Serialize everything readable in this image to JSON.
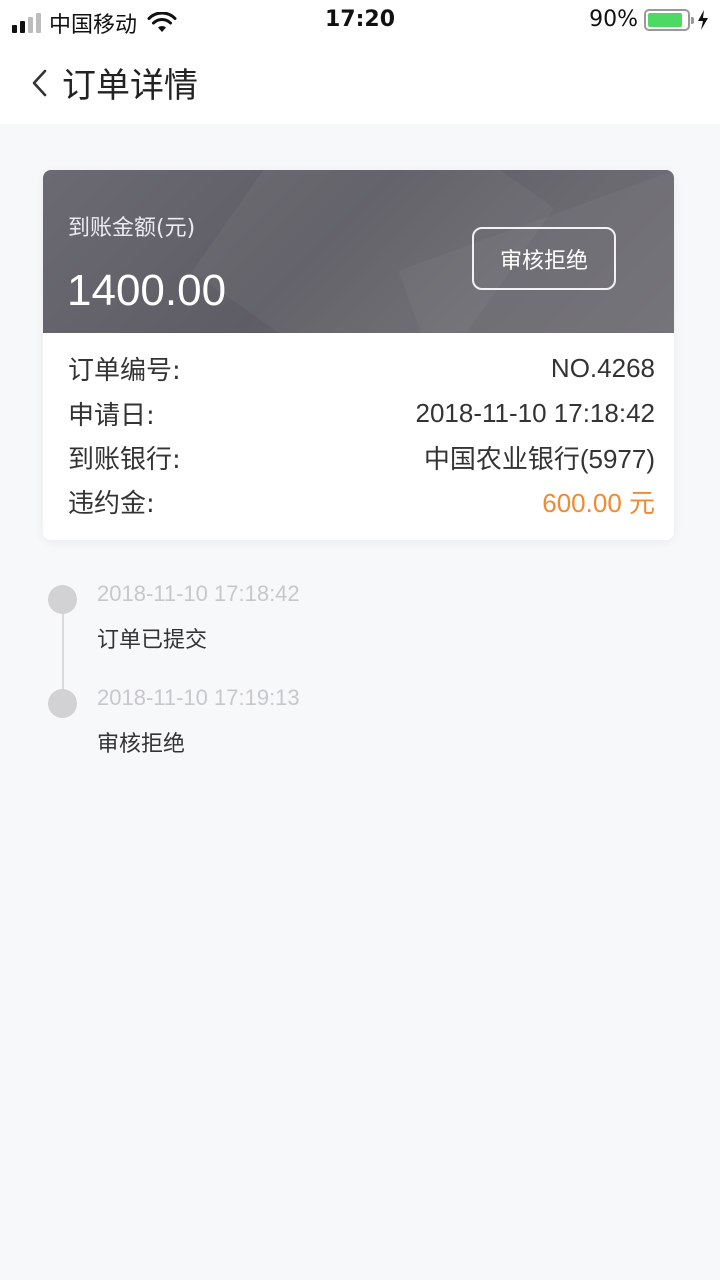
{
  "status_bar": {
    "carrier": "中国移动",
    "time": "17:20",
    "battery": "90%",
    "battery_level": 0.9,
    "signal_bars": 4,
    "signal_active": 2
  },
  "nav": {
    "title": "订单详情",
    "back_icon": "chevron-left-icon"
  },
  "summary": {
    "amount_label": "到账金额(元)",
    "amount": "1400.00",
    "status": "审核拒绝"
  },
  "details": [
    {
      "label": "订单编号:",
      "value": "NO.4268",
      "highlight": false
    },
    {
      "label": "申请日:",
      "value": "2018-11-10 17:18:42",
      "highlight": false
    },
    {
      "label": "到账银行:",
      "value": "中国农业银行(5977)",
      "highlight": false
    },
    {
      "label": "违约金:",
      "value": "600.00 元",
      "highlight": true
    }
  ],
  "timeline": [
    {
      "time": "2018-11-10 17:18:42",
      "text": "订单已提交"
    },
    {
      "time": "2018-11-10 17:19:13",
      "text": "审核拒绝"
    }
  ],
  "colors": {
    "accent_orange": "#f08a33",
    "card_header": "#65646b",
    "battery_green": "#4cd964"
  }
}
